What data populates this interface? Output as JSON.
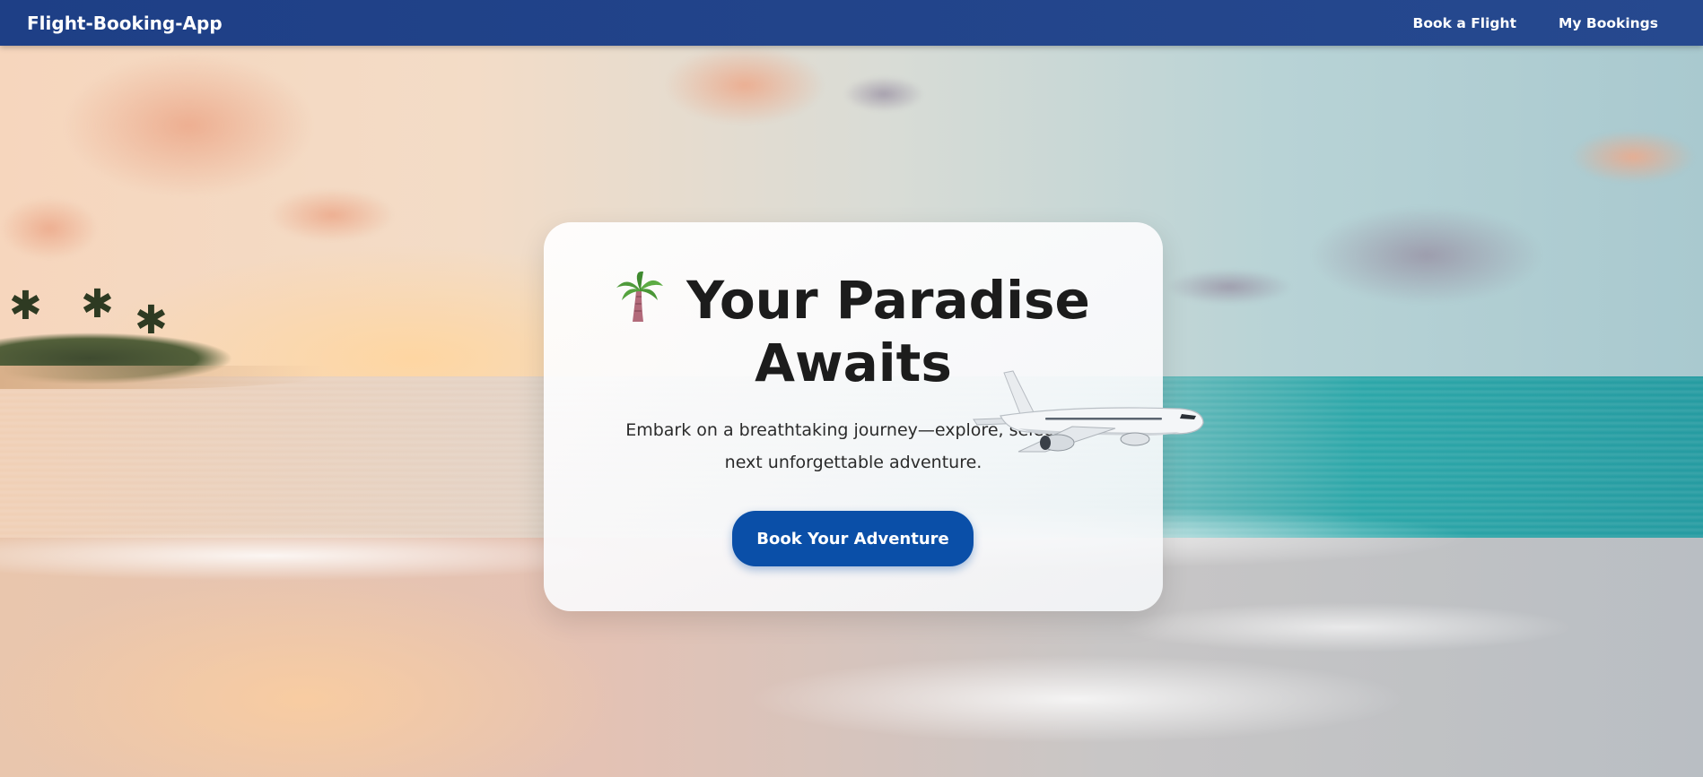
{
  "navbar": {
    "brand": "Flight-Booking-App",
    "links": [
      {
        "label": "Book a Flight"
      },
      {
        "label": "My Bookings"
      }
    ]
  },
  "hero": {
    "title_line1": "Your Paradise",
    "title_line2": "Awaits",
    "subtitle_line1": "Embark on a breathtaking journey—explore, select, a",
    "subtitle_line2": "next unforgettable adventure.",
    "cta_label": "Book Your Adventure",
    "icons": [
      "palm-tree-icon",
      "airplane-icon"
    ]
  },
  "colors": {
    "navbar": "#1e3f86",
    "cta": "#0a4fa8",
    "title": "#1c1c1c"
  }
}
